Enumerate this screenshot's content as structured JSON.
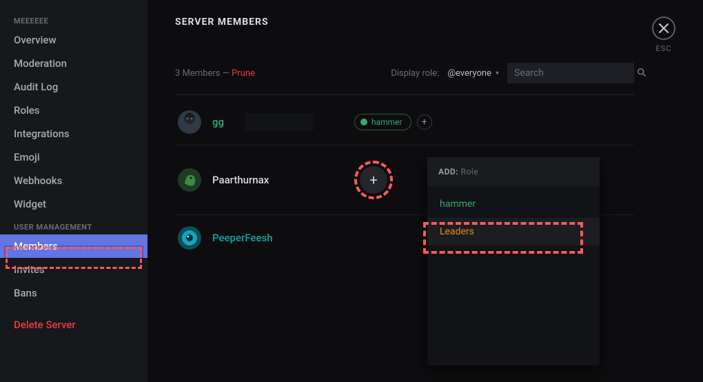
{
  "sidebar": {
    "section1_title": "MEEEEEE",
    "section2_title": "USER MANAGEMENT",
    "items1": [
      {
        "label": "Overview"
      },
      {
        "label": "Moderation"
      },
      {
        "label": "Audit Log"
      },
      {
        "label": "Roles"
      },
      {
        "label": "Integrations"
      },
      {
        "label": "Emoji"
      },
      {
        "label": "Webhooks"
      },
      {
        "label": "Widget"
      }
    ],
    "items2": [
      {
        "label": "Members"
      },
      {
        "label": "Invites"
      },
      {
        "label": "Bans"
      }
    ],
    "delete_label": "Delete Server"
  },
  "header": {
    "title": "SERVER MEMBERS",
    "close_label": "ESC"
  },
  "toolbar": {
    "count_text": "3 Members —",
    "prune_label": "Prune",
    "display_role_label": "Display role:",
    "role_selected": "@everyone",
    "search_placeholder": "Search"
  },
  "members": [
    {
      "name": "gg",
      "color": "green",
      "owner": true,
      "roles": [
        {
          "name": "hammer"
        }
      ]
    },
    {
      "name": "Paarthurnax",
      "color": "white",
      "owner": false,
      "roles": []
    },
    {
      "name": "PeeperFeesh",
      "color": "teal",
      "owner": false,
      "roles": []
    }
  ],
  "role_popup": {
    "add_label": "ADD:",
    "role_label": "Role",
    "options": [
      {
        "label": "hammer",
        "klass": "green"
      },
      {
        "label": "Leaders",
        "klass": "orange"
      }
    ]
  }
}
